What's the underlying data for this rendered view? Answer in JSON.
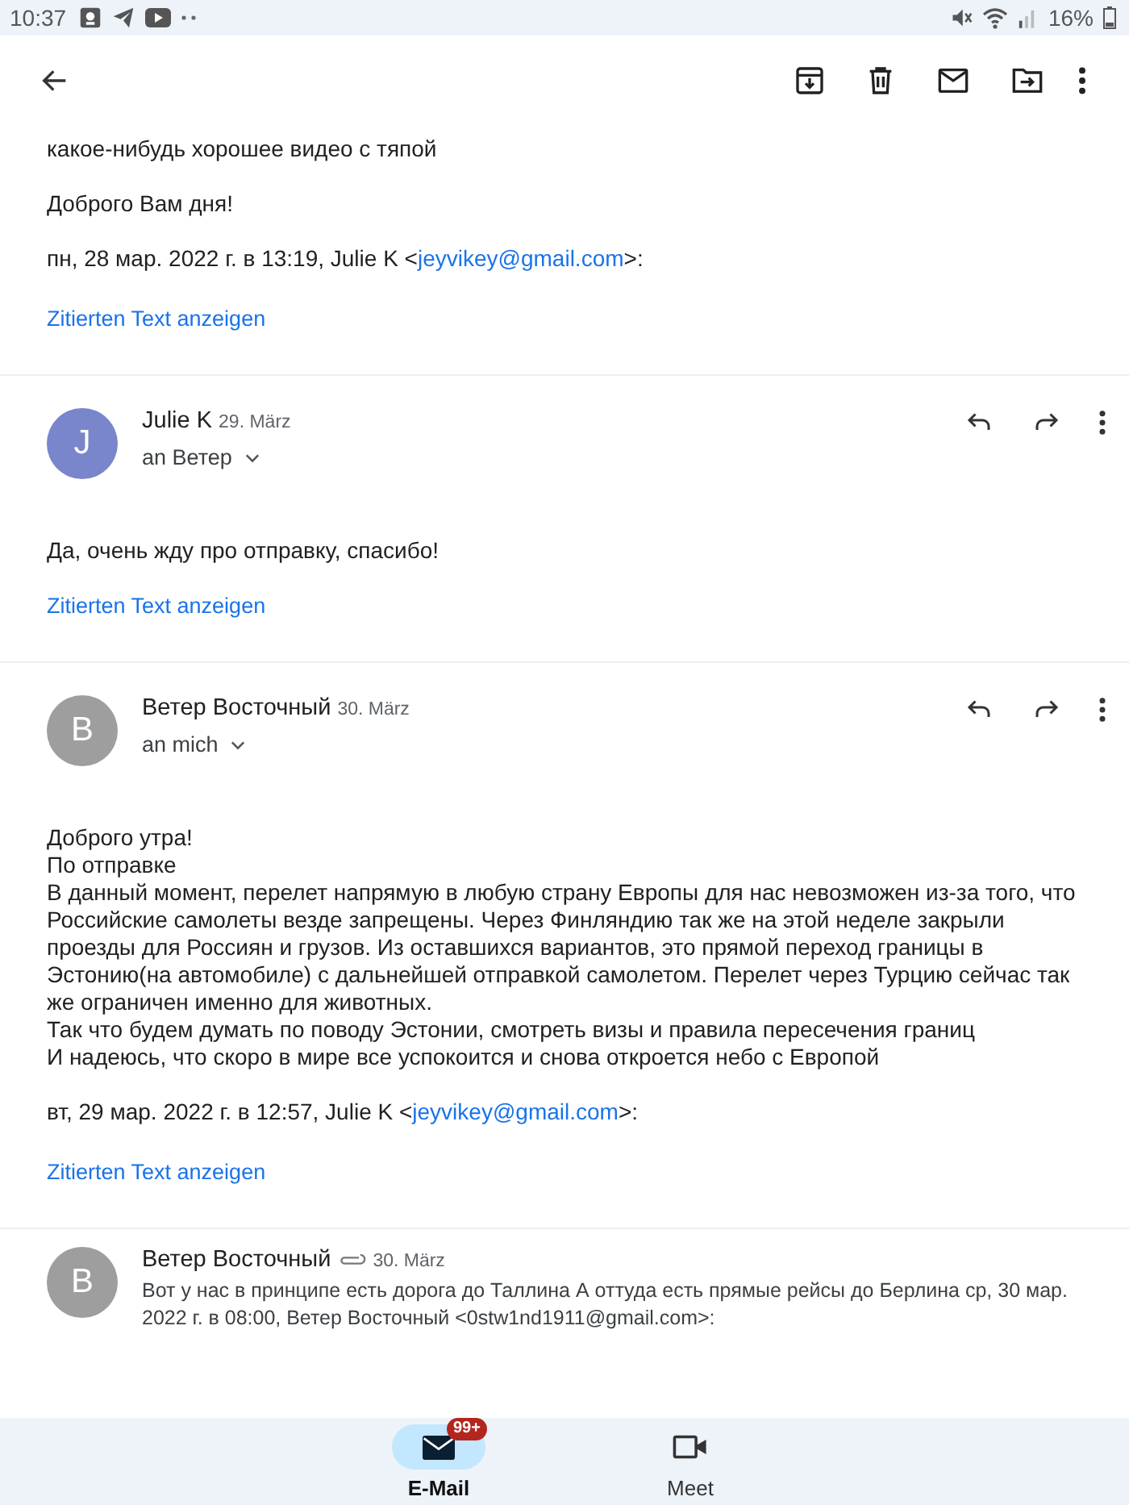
{
  "status_bar": {
    "time": "10:37",
    "battery": "16%"
  },
  "messages": [
    {
      "kind": "tail",
      "paragraphs": [
        [
          "какое-нибудь хорошее видео с тяпой"
        ],
        [
          "Доброго Вам дня!"
        ]
      ],
      "quote": {
        "prefix": "пн, 28 мар. 2022 г. в 13:19, Julie K <",
        "email": "jeyvikey@gmail.com",
        "suffix": ">:"
      },
      "show_quoted": "Zitierten Text anzeigen"
    },
    {
      "kind": "expanded",
      "avatar": "J",
      "color": "#7986cb",
      "sender": "Julie K",
      "date": "29. März",
      "recipient": "an Ветер",
      "paragraphs": [
        [
          "Да, очень жду про отправку, спасибо!"
        ]
      ],
      "show_quoted": "Zitierten Text anzeigen"
    },
    {
      "kind": "expanded",
      "avatar": "B",
      "color": "#9e9e9e",
      "sender": "Ветер Восточный",
      "date": "30. März",
      "recipient": "an mich",
      "paragraphs": [
        [
          "Доброго утра!",
          "По отправке",
          "В данный момент, перелет напрямую в любую страну Европы для нас невозможен из-за того, что Российские самолеты везде запрещены. Через Финляндию так же на этой неделе закрыли проезды для Россиян и грузов. Из оставшихся вариантов, это прямой переход границы в Эстонию(на автомобиле) с дальнейшей отправкой самолетом. Перелет через Турцию сейчас так же ограничен именно для животных.",
          "Так что будем думать по поводу Эстонии, смотреть визы и правила пересечения границ",
          "И надеюсь, что скоро в мире все успокоится и снова откроется небо с Европой"
        ]
      ],
      "quote": {
        "prefix": "вт, 29 мар. 2022 г. в 12:57, Julie K <",
        "email": "jeyvikey@gmail.com",
        "suffix": ">:"
      },
      "show_quoted": "Zitierten Text anzeigen"
    },
    {
      "kind": "collapsed",
      "avatar": "B",
      "color": "#9e9e9e",
      "sender": "Ветер Восточный",
      "attachment": true,
      "date": "30. März",
      "snippet": "Вот у нас в принципе есть дорога до Таллина А оттуда есть прямые рейсы до Берлина ср, 30 мар. 2022 г. в 08:00, Ветер Восточный <0stw1nd1911@gmail.com>:"
    }
  ],
  "bottom_nav": [
    {
      "kind": "mail",
      "label": "E-Mail",
      "selected": true,
      "badge": "99+"
    },
    {
      "kind": "video",
      "label": "Meet",
      "selected": false
    }
  ]
}
